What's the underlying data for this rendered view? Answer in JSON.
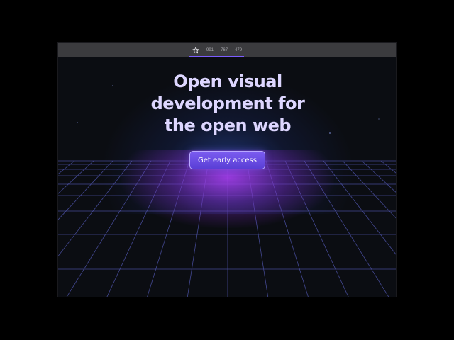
{
  "toolbar": {
    "breakpoints": [
      "991",
      "767",
      "479"
    ],
    "active_icon": "star-icon"
  },
  "hero": {
    "title_lines": [
      "Open visual",
      "development for",
      "the open web"
    ],
    "cta_label": "Get early access"
  },
  "colors": {
    "background": "#0b0d12",
    "title": "#ddd6ff",
    "accent": "#6c4fe6",
    "grid_line": "#4a4fa0",
    "glow_purple": "#b43cff",
    "glow_blue": "#325ac8"
  }
}
